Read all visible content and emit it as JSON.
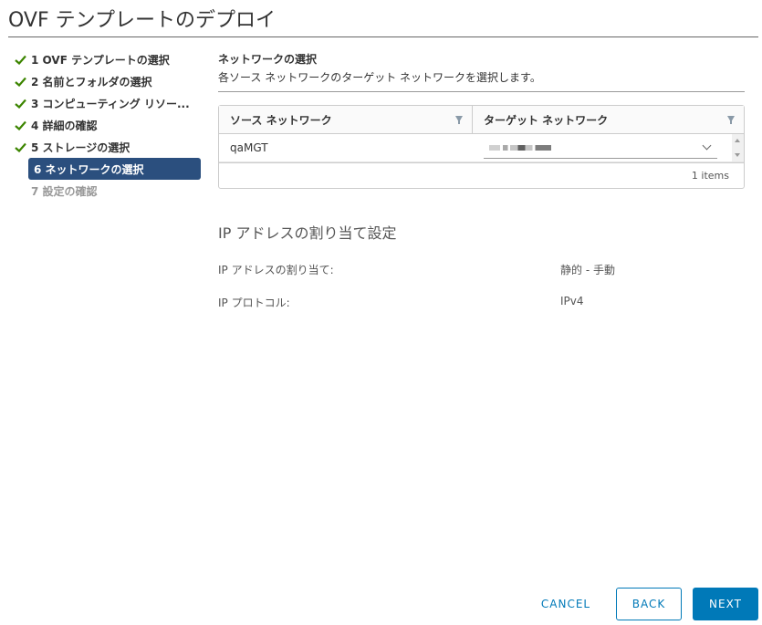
{
  "window": {
    "title": "OVF テンプレートのデプロイ"
  },
  "steps": [
    {
      "label": "1 OVF テンプレートの選択",
      "state": "done"
    },
    {
      "label": "2 名前とフォルダの選択",
      "state": "done"
    },
    {
      "label": "3 コンピューティング リソー...",
      "state": "done"
    },
    {
      "label": "4 詳細の確認",
      "state": "done"
    },
    {
      "label": "5 ストレージの選択",
      "state": "done"
    },
    {
      "label": "6 ネットワークの選択",
      "state": "active"
    },
    {
      "label": "7 設定の確認",
      "state": "disabled"
    }
  ],
  "section": {
    "title": "ネットワークの選択",
    "description": "各ソース ネットワークのターゲット ネットワークを選択します。"
  },
  "grid": {
    "columns": [
      "ソース ネットワーク",
      "ターゲット ネットワーク"
    ],
    "rows": [
      {
        "source": "qaMGT"
      }
    ],
    "footer": "1 items"
  },
  "ip": {
    "title": "IP アドレスの割り当て設定",
    "allocation_label": "IP アドレスの割り当て:",
    "allocation_value": "静的 - 手動",
    "protocol_label": "IP プロトコル:",
    "protocol_value": "IPv4"
  },
  "buttons": {
    "cancel": "CANCEL",
    "back": "BACK",
    "next": "NEXT"
  },
  "colors": {
    "accent": "#0079b8",
    "active_step": "#2b4f7e",
    "check": "#3c8500"
  }
}
